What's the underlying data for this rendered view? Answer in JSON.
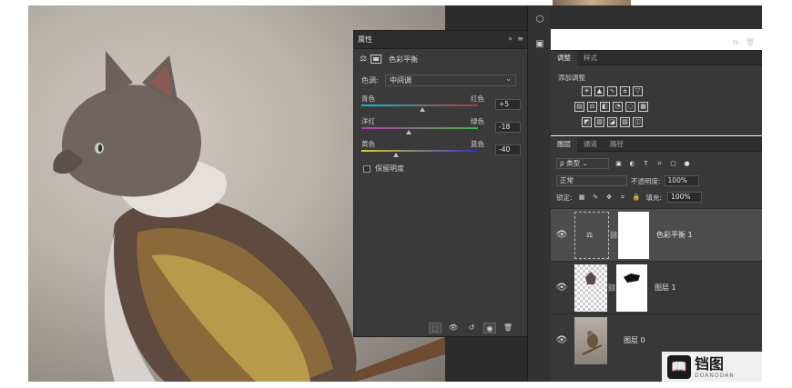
{
  "properties_panel": {
    "tab": "属性",
    "collapse": "»",
    "menu": "≡",
    "adjustment_name": "色彩平衡",
    "tone_label": "色调:",
    "tone_value": "中间调",
    "sliders": [
      {
        "left": "青色",
        "right": "红色",
        "value": "+5",
        "position": 0.52
      },
      {
        "left": "洋红",
        "right": "绿色",
        "value": "-18",
        "position": 0.41
      },
      {
        "left": "黄色",
        "right": "蓝色",
        "value": "-40",
        "position": 0.3
      }
    ],
    "preserve_luminosity": "保留明度",
    "footer_icons": [
      "clip-icon",
      "view-previous-icon",
      "reset-icon",
      "visibility-icon",
      "delete-icon"
    ]
  },
  "adjustments_panel": {
    "tabs": [
      "调整",
      "样式"
    ],
    "caption": "添加调整",
    "icons_row1": [
      "brightness-icon",
      "levels-icon",
      "curves-icon",
      "exposure-icon",
      "vibrance-icon"
    ],
    "icons_row2": [
      "hue-icon",
      "color-balance-icon",
      "bw-icon",
      "photo-filter-icon",
      "channel-mixer-icon",
      "lookup-icon"
    ],
    "icons_row3": [
      "invert-icon",
      "posterize-icon",
      "threshold-icon",
      "gradient-map-icon",
      "selective-color-icon"
    ]
  },
  "layers_panel": {
    "tabs": [
      "图层",
      "通道",
      "路径"
    ],
    "kind": "类型",
    "blend_mode": "正常",
    "opacity_label": "不透明度:",
    "opacity_value": "100%",
    "lock_label": "锁定:",
    "fill_label": "填充:",
    "fill_value": "100%",
    "layers": [
      {
        "name": "色彩平衡 1",
        "type": "adjustment"
      },
      {
        "name": "图层 1",
        "type": "masked"
      },
      {
        "name": "图层 0",
        "type": "photo"
      }
    ]
  },
  "watermark": {
    "cn": "铛图",
    "en": "DOANOOAN"
  }
}
